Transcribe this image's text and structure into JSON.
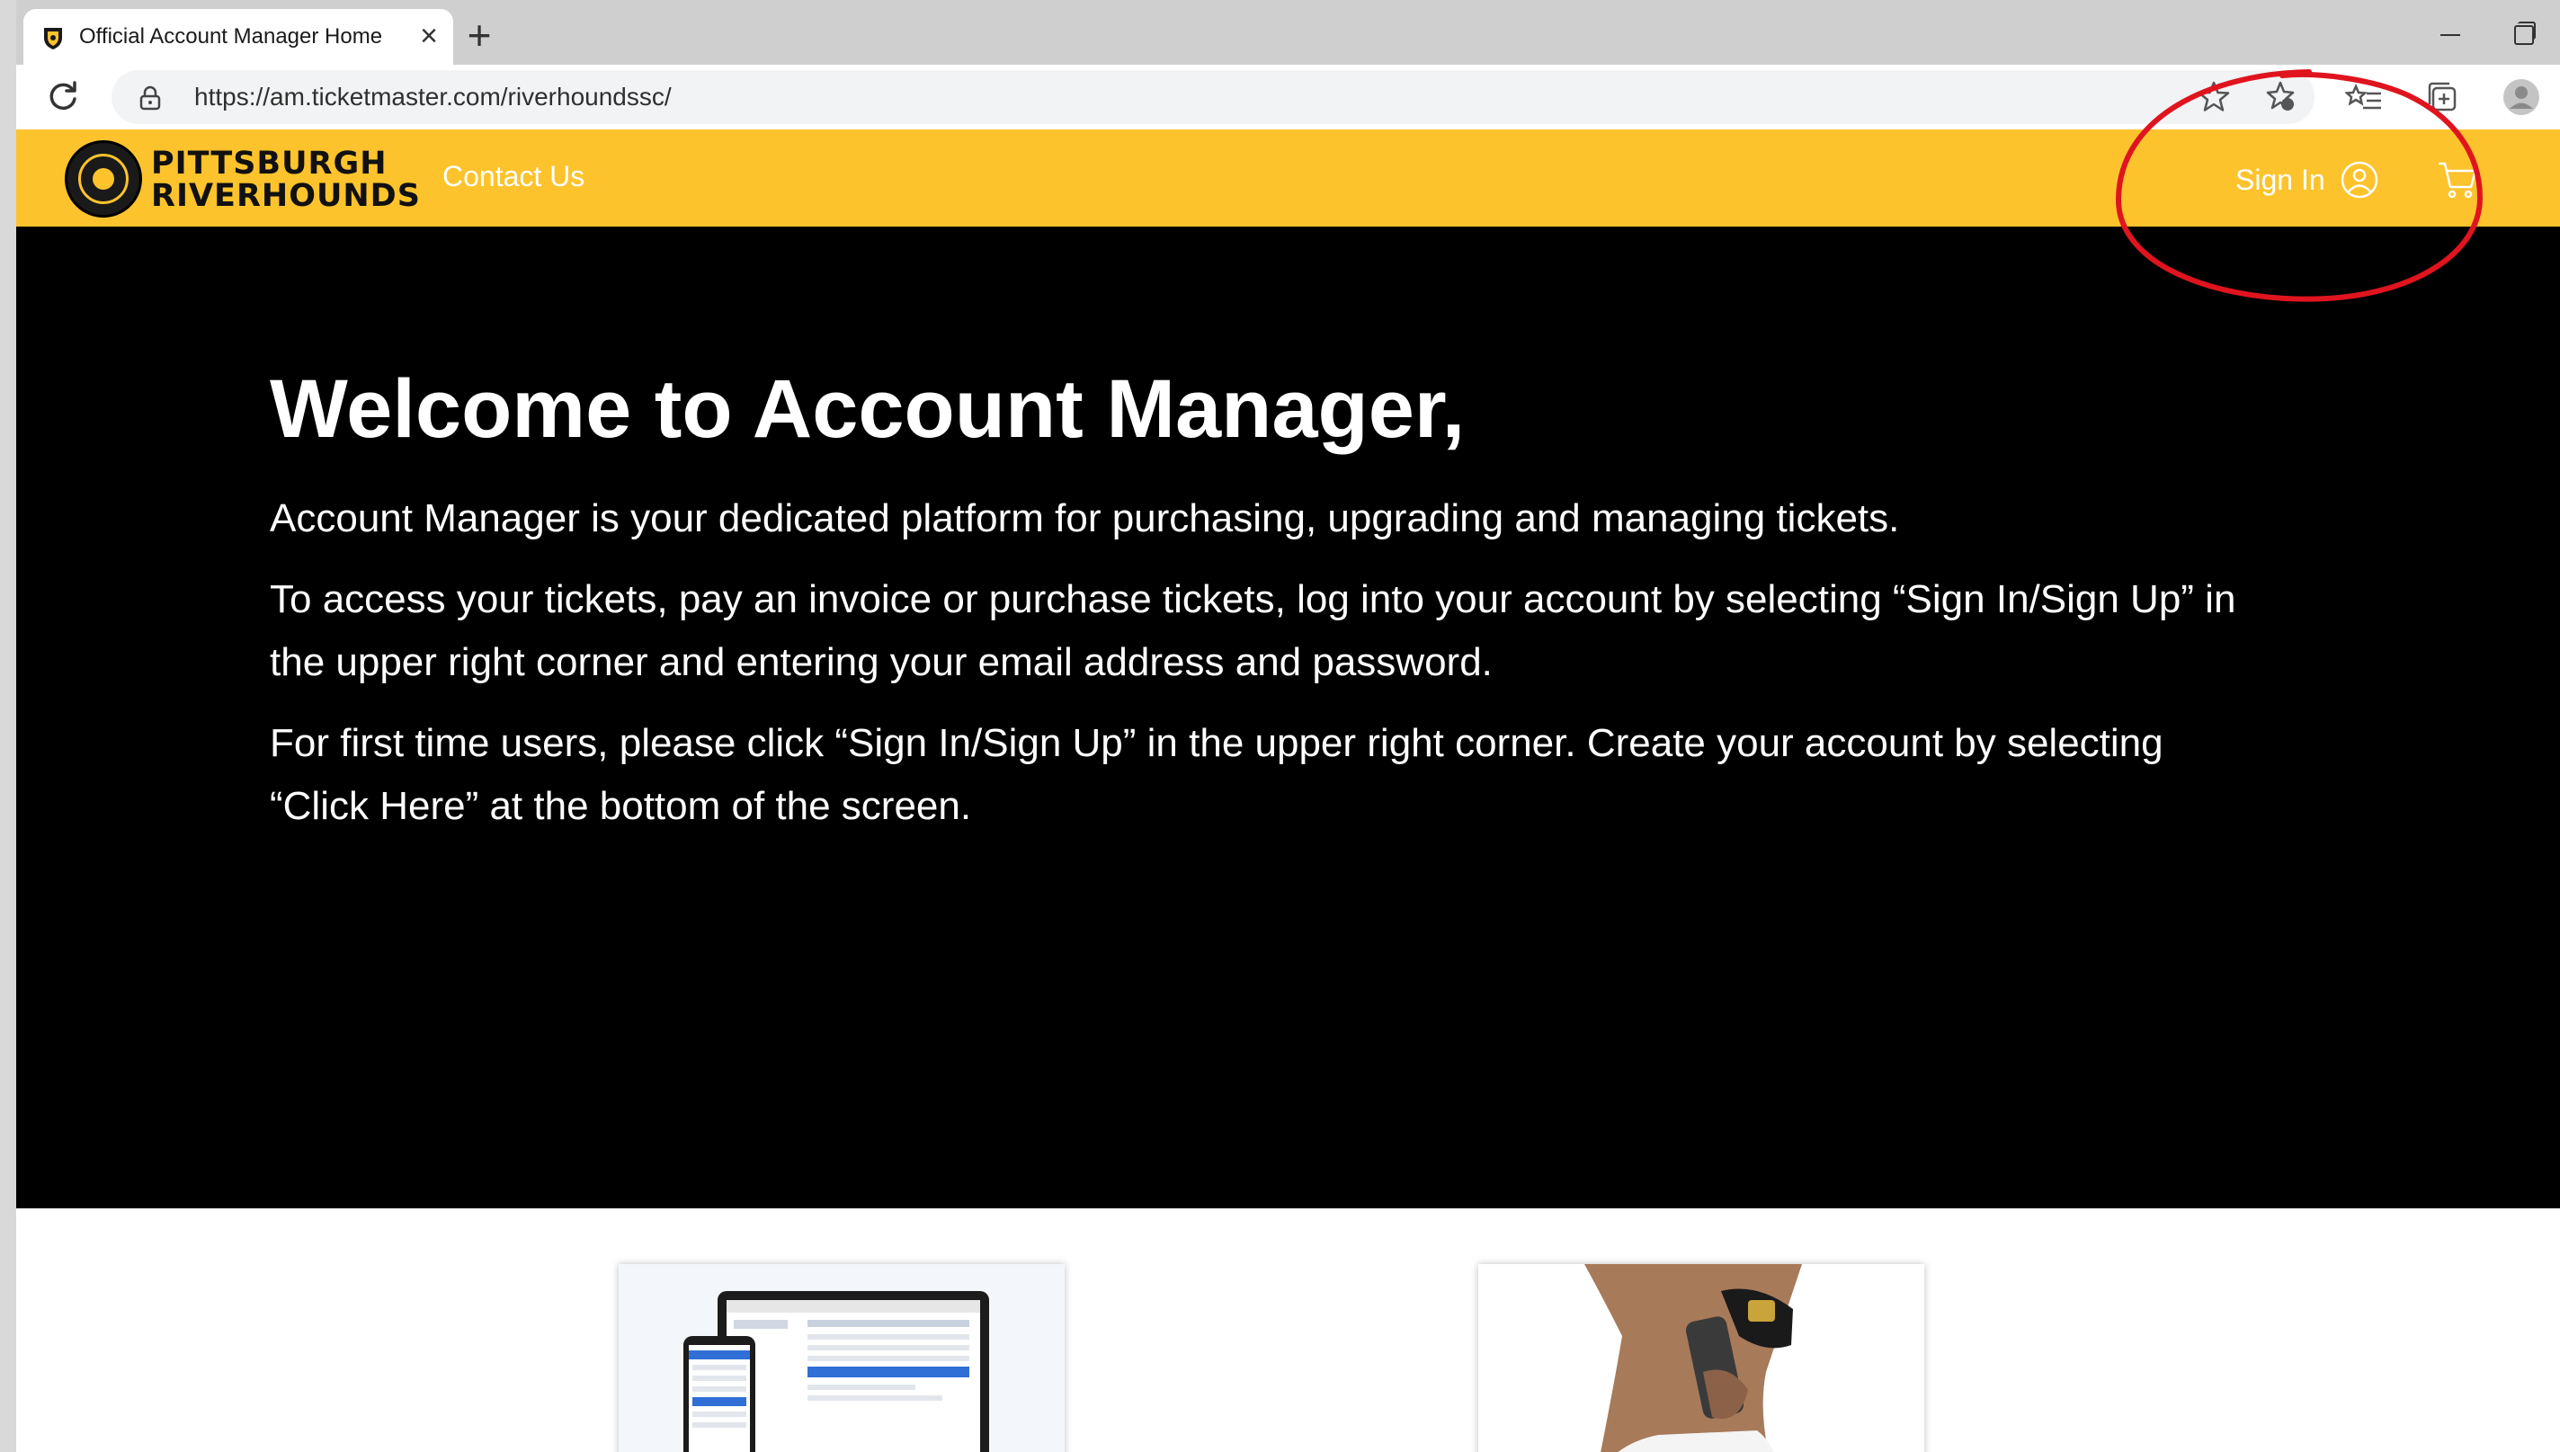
{
  "browser": {
    "tab_title": "Official Account Manager Home",
    "tab_close_glyph": "×",
    "new_tab_glyph": "+",
    "url": "https://am.ticketmaster.com/riverhoundssc/"
  },
  "site": {
    "logo_line1": "PITTSBURGH",
    "logo_line2": "RIVERHOUNDS",
    "contact_label": "Contact Us",
    "signin_label": "Sign In",
    "brand_color": "#fdc32c"
  },
  "hero": {
    "title": "Welcome to Account Manager,",
    "paragraph1": "Account Manager is your dedicated platform for purchasing, upgrading and managing tickets.",
    "paragraph2": "To access your tickets, pay an invoice or purchase tickets, log into your account by selecting “Sign In/Sign Up” in the upper right corner and entering your email address and password.",
    "paragraph3": "For first time users, please click “Sign In/Sign Up” in the upper right corner. Create your account by selecting “Click Here” at the bottom of the screen."
  },
  "annotation": {
    "color": "#e0141e",
    "shape": "hand-drawn circle"
  },
  "icons": [
    "favicon-icon",
    "reload-icon",
    "lock-icon",
    "star-icon",
    "extensions-icon",
    "favorites-icon",
    "collections-icon",
    "profile-icon",
    "user-icon",
    "cart-icon"
  ]
}
